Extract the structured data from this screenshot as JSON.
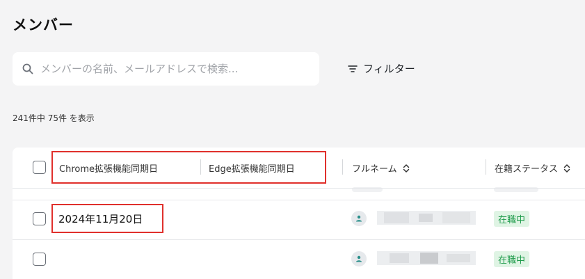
{
  "page": {
    "title": "メンバー"
  },
  "search": {
    "placeholder": "メンバーの名前、メールアドレスで検索..."
  },
  "filter": {
    "label": "フィルター"
  },
  "result_summary": "241件中 75件 を表示",
  "table": {
    "columns": [
      {
        "label": "Chrome拡張機能同期日"
      },
      {
        "label": "Edge拡張機能同期日"
      },
      {
        "label": "フルネーム"
      },
      {
        "label": "在籍ステータス"
      }
    ],
    "rows": [
      {
        "chrome_sync_date": "2024年11月20日",
        "status": "在職中"
      },
      {
        "chrome_sync_date": "",
        "status": "在職中"
      }
    ]
  },
  "colors": {
    "highlight": "#e0302c",
    "status_bg": "#dff4e4",
    "status_text": "#1f9b4b",
    "avatar_icon": "#2a8f8a"
  }
}
